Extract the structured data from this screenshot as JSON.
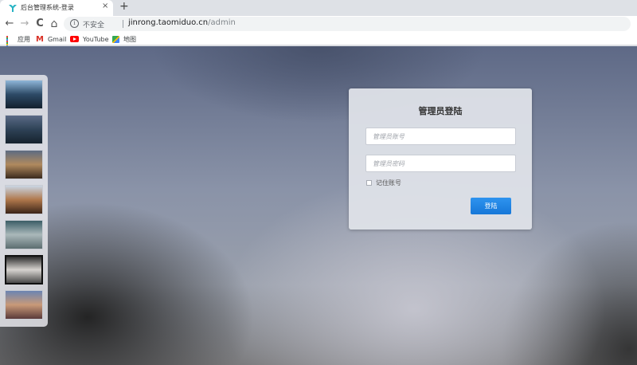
{
  "browser": {
    "tab": {
      "title": "后台管理系统-登录",
      "close_glyph": "×"
    },
    "new_tab_glyph": "+",
    "nav": {
      "back": "←",
      "forward": "→",
      "reload": "C",
      "home": "⌂"
    },
    "omnibox": {
      "security_icon": "i",
      "security_label": "不安全",
      "url_host": "jinrong.taomiduo.cn",
      "url_path": "/admin"
    },
    "bookmarks": [
      {
        "label": "应用",
        "icon": "apps-grid-icon"
      },
      {
        "label": "Gmail",
        "icon": "gmail-icon"
      },
      {
        "label": "YouTube",
        "icon": "youtube-icon"
      },
      {
        "label": "地图",
        "icon": "maps-icon"
      }
    ],
    "gmail_icon_glyph": "M"
  },
  "thumbnails": [
    {
      "colors": [
        "#8fb6d8",
        "#2d4a66",
        "#13202e"
      ],
      "selected": false
    },
    {
      "colors": [
        "#5a6a86",
        "#2e4256",
        "#16222e"
      ],
      "selected": false
    },
    {
      "colors": [
        "#5d6b82",
        "#b08a5e",
        "#3a2a1e"
      ],
      "selected": false
    },
    {
      "colors": [
        "#c9d6e4",
        "#b0784c",
        "#3a2418"
      ],
      "selected": false
    },
    {
      "colors": [
        "#3b5d66",
        "#aab8ba",
        "#5c6d70"
      ],
      "selected": false
    },
    {
      "colors": [
        "#2a2a2a",
        "#d7d3cf",
        "#4a4a4a"
      ],
      "selected": true
    },
    {
      "colors": [
        "#6b84b2",
        "#c99a78",
        "#5a3a3a"
      ],
      "selected": false
    }
  ],
  "login": {
    "title": "管理员登陆",
    "username_placeholder": "管理员账号",
    "password_placeholder": "管理员密码",
    "remember_label": "记住账号",
    "submit_label": "登陆"
  }
}
